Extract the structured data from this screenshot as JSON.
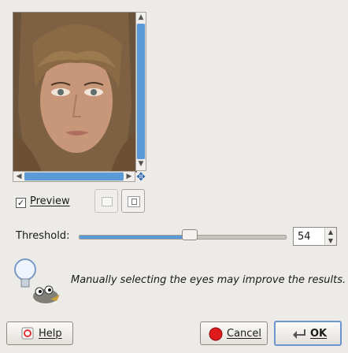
{
  "preview": {
    "checkbox_state": "checked",
    "label": "Preview"
  },
  "threshold": {
    "label": "Threshold:",
    "value": "54",
    "slider_fraction": 0.54
  },
  "hint": {
    "text": "Manually selecting the eyes may improve the results."
  },
  "buttons": {
    "help": "Help",
    "cancel": "Cancel",
    "ok": "OK"
  },
  "icons": {
    "checkbox": "checkmark-icon",
    "nav": "move-arrows-icon",
    "hint": "lightbulb-wilber-icon",
    "help": "help-icon",
    "cancel": "record-stop-icon",
    "ok": "enter-arrow-icon"
  },
  "colors": {
    "accent": "#5a9ad8",
    "cancel_icon": "#e01a1a",
    "background": "#edebe7"
  }
}
